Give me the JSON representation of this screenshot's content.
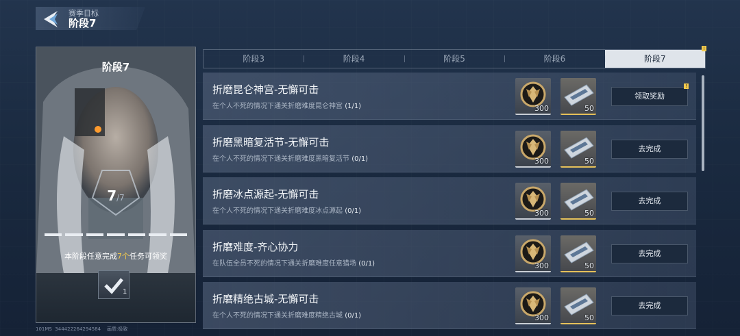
{
  "header": {
    "subtitle": "赛季目标",
    "title": "阶段7"
  },
  "stage_card": {
    "title": "阶段7",
    "count_current": "7",
    "count_total": "/7",
    "desc_prefix": "本阶段任意完成",
    "desc_highlight": "7个",
    "desc_suffix": "任务可领奖",
    "reward_count": "1",
    "progress_segments": 7
  },
  "tabs": [
    {
      "label": "阶段3"
    },
    {
      "label": "阶段4"
    },
    {
      "label": "阶段5"
    },
    {
      "label": "阶段6"
    },
    {
      "label": "阶段7",
      "active": true,
      "badge": "!"
    }
  ],
  "quests": [
    {
      "title": "折磨昆仑神宫-无懈可击",
      "desc": "在个人不死的情况下通关折磨难度昆仑神宫",
      "progress": "(1/1)",
      "coin": "300",
      "ticket": "50",
      "button": "领取奖励",
      "badge": "!"
    },
    {
      "title": "折磨黑暗复活节-无懈可击",
      "desc": "在个人不死的情况下通关折磨难度黑暗复活节",
      "progress": "(0/1)",
      "coin": "300",
      "ticket": "50",
      "button": "去完成"
    },
    {
      "title": "折磨冰点源起-无懈可击",
      "desc": "在个人不死的情况下通关折磨难度冰点源起",
      "progress": "(0/1)",
      "coin": "300",
      "ticket": "50",
      "button": "去完成"
    },
    {
      "title": "折磨难度-齐心协力",
      "desc": "在队伍全员不死的情况下通关折磨难度任意猎场",
      "progress": "(0/1)",
      "coin": "300",
      "ticket": "50",
      "button": "去完成"
    },
    {
      "title": "折磨精绝古城-无懈可击",
      "desc": "在个人不死的情况下通关折磨难度精绝古城",
      "progress": "(0/1)",
      "coin": "300",
      "ticket": "50",
      "button": "去完成"
    }
  ],
  "footer": {
    "ping": "101MS",
    "uid": "344422264294584",
    "quality_label": "画质:",
    "quality_value": "极致"
  },
  "colors": {
    "accent": "#f2c94c",
    "tab_active": "#dfe4ea"
  }
}
